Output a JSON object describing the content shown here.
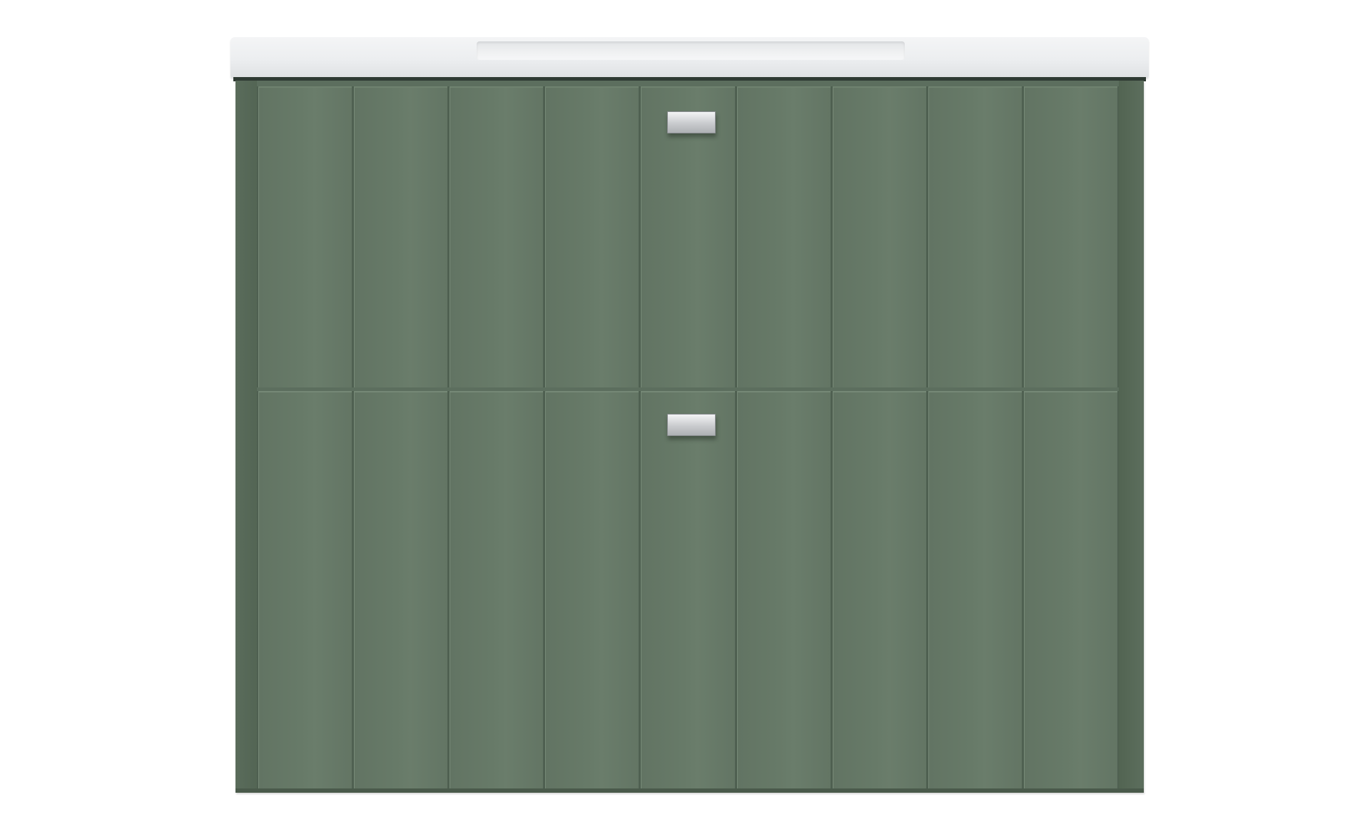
{
  "product": {
    "type": "bathroom-vanity",
    "cabinet_color": "#5f715f",
    "countertop_color": "#eef0f1",
    "handle_color": "#c4c6c9",
    "drawer_count": 2,
    "slats_per_drawer": 9
  }
}
